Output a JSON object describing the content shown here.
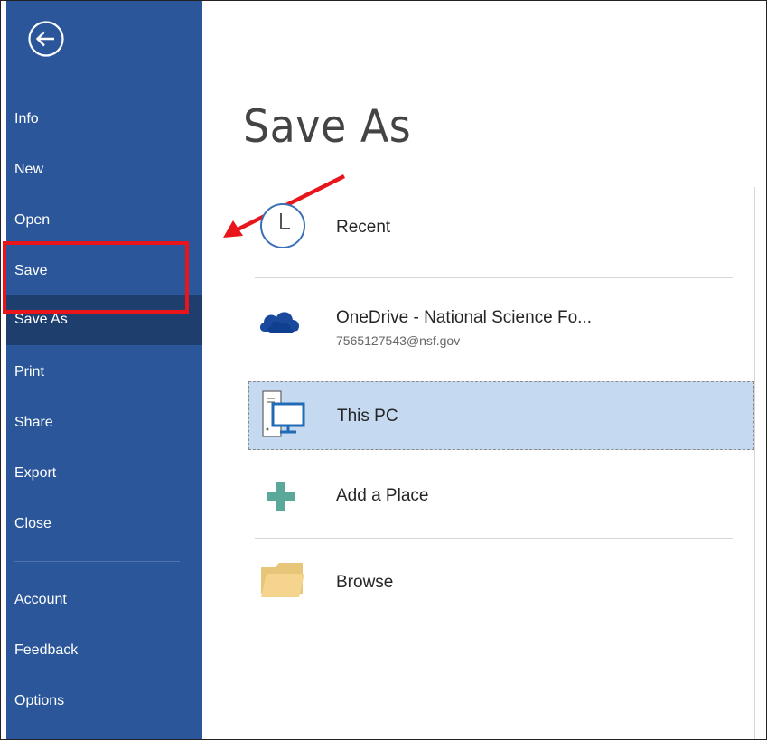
{
  "sidebar": {
    "back_icon": "back-arrow-icon",
    "items": [
      {
        "label": "Info"
      },
      {
        "label": "New"
      },
      {
        "label": "Open"
      },
      {
        "label": "Save"
      },
      {
        "label": "Save As",
        "selected": true
      },
      {
        "label": "Print"
      },
      {
        "label": "Share"
      },
      {
        "label": "Export"
      },
      {
        "label": "Close"
      }
    ],
    "footer_items": [
      {
        "label": "Account"
      },
      {
        "label": "Feedback"
      },
      {
        "label": "Options"
      }
    ],
    "background_color": "#2b579a",
    "selected_color": "#1e3e6e"
  },
  "main": {
    "title": "Save As",
    "locations": [
      {
        "label": "Recent",
        "icon": "clock-icon"
      },
      {
        "label": "OneDrive - National Science Fo...",
        "sub": "7565127543@nsf.gov",
        "icon": "onedrive-cloud-icon"
      },
      {
        "label": "This PC",
        "icon": "computer-icon",
        "selected": true
      },
      {
        "label": "Add a Place",
        "icon": "plus-icon"
      },
      {
        "label": "Browse",
        "icon": "folder-icon"
      }
    ]
  },
  "annotations": {
    "highlight_color": "#e8151b"
  }
}
